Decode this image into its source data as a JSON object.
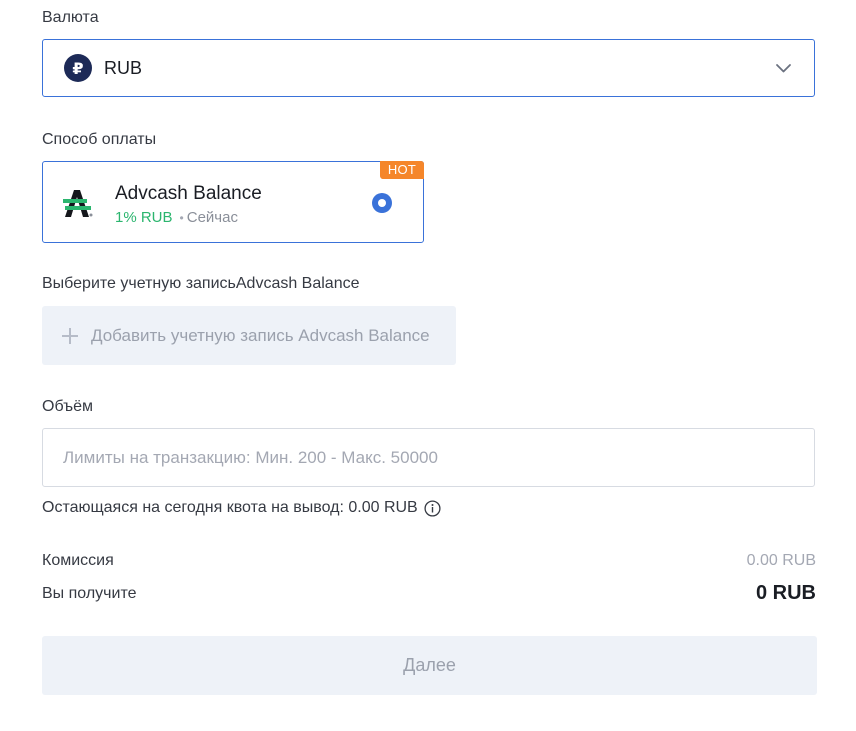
{
  "currency": {
    "label": "Валюта",
    "selected": "RUB",
    "icon": "ruble-coin-icon",
    "icon_glyph": "₽",
    "icon_color": "#1d2a57"
  },
  "payment_method": {
    "label": "Способ оплаты",
    "badge": "HOT",
    "name": "Advcash Balance",
    "fee": "1% RUB",
    "separator": "•",
    "time": "Сейчас",
    "selected": true,
    "accent_color": "#3a72d9",
    "badge_color": "#f5862a"
  },
  "account": {
    "label": "Выберите учетную записьAdvcash Balance",
    "add_label": "Добавить учетную запись Advcash Balance"
  },
  "amount": {
    "label": "Объём",
    "value": "",
    "placeholder": "Лимиты на транзакцию: Мин. 200 - Макс. 50000"
  },
  "quota": {
    "text": "Остающаяся на сегодня квота на вывод: 0.00 RUB"
  },
  "summary": {
    "fee_label": "Комиссия",
    "fee_value": "0.00 RUB",
    "receive_label": "Вы получите",
    "receive_value": "0 RUB"
  },
  "actions": {
    "next_label": "Далее"
  }
}
